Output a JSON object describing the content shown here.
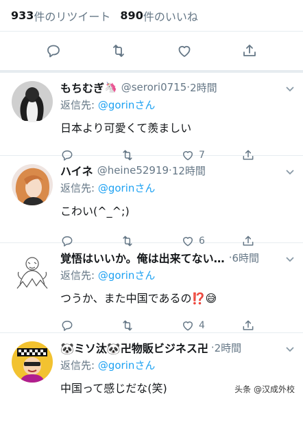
{
  "stats": {
    "retweets": "933",
    "retweets_label": "件のリツイート",
    "likes": "890",
    "likes_label": "件のいいね"
  },
  "replies": [
    {
      "name": "もちむぎ",
      "name_suffix": "🦄",
      "handle": "@serori0715",
      "time": "2時間",
      "reply_prefix": "返信先: ",
      "mention": "@gorin",
      "mention_suffix": "さん",
      "text": "日本より可愛くて羨ましい",
      "retweet_count": "",
      "like_count": "7"
    },
    {
      "name": "ハイネ",
      "name_suffix": "",
      "handle": "@heine52919",
      "time": "12時間",
      "reply_prefix": "返信先: ",
      "mention": "@gorin",
      "mention_suffix": "さん",
      "text": "こわい(^_^;)",
      "retweet_count": "",
      "like_count": "6"
    },
    {
      "name": "覚悟はいいか。俺は出来てない…",
      "name_suffix": "",
      "handle": "",
      "time": "6時間",
      "reply_prefix": "返信先: ",
      "mention": "@gorin",
      "mention_suffix": "さん",
      "text": "つうか、また中国であるの⁉️😅",
      "retweet_count": "",
      "like_count": "4"
    },
    {
      "name": "🐼ミソ汰🐼卍物販ビジネス卍",
      "name_suffix": "",
      "handle": "",
      "time": "2時間",
      "reply_prefix": "返信先: ",
      "mention": "@gorin",
      "mention_suffix": "さん",
      "text": "中国って感じだな(笑)",
      "retweet_count": "",
      "like_count": ""
    }
  ],
  "watermark": "头条 @汉成外校",
  "colors": {
    "link": "#1da1f2",
    "muted": "#657786",
    "border": "#e6ecf0"
  }
}
